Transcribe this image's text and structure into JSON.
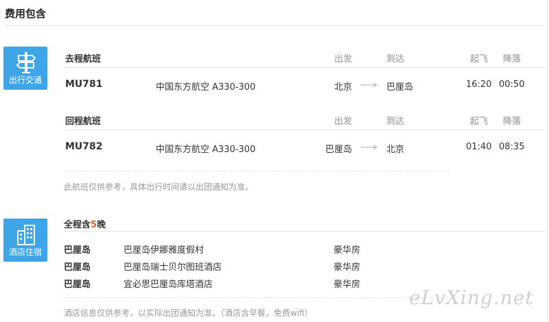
{
  "section_title": "费用包含",
  "transport": {
    "badge_label": "出行交通",
    "col_depart": "出发",
    "col_arrive": "到达",
    "col_takeoff": "起飞",
    "col_landing": "降落",
    "outbound": {
      "label": "去程航班",
      "flight_no": "MU781",
      "airline": "中国东方航空 A330-300",
      "from": "北京",
      "to": "巴厘岛",
      "takeoff": "16:20",
      "landing": "00:50"
    },
    "return": {
      "label": "回程航班",
      "flight_no": "MU782",
      "airline": "中国东方航空 A330-300",
      "from": "巴厘岛",
      "to": "北京",
      "takeoff": "01:40",
      "landing": "08:35"
    },
    "note": "此航班仅供参考，具体出行时间请以出团通知为准。"
  },
  "hotel": {
    "badge_label": "酒店住宿",
    "total_prefix": "全程含",
    "total_nights": "5",
    "total_suffix": "晚",
    "rows": [
      {
        "city": "巴厘岛",
        "name": "巴厘岛伊娜雅度假村",
        "room": "豪华房"
      },
      {
        "city": "巴厘岛",
        "name": "巴厘岛瑞士贝尔图班酒店",
        "room": "豪华房"
      },
      {
        "city": "巴厘岛",
        "name": "宜必思巴厘岛库塔酒店",
        "room": "豪华房"
      }
    ],
    "note": "酒店信息仅供参考，以实际出团通知为准。（酒店含早餐，免费wifi）"
  },
  "watermark": "eLvXing.net",
  "colors": {
    "badge": "#3ea6e8",
    "accent": "#f05a28"
  }
}
